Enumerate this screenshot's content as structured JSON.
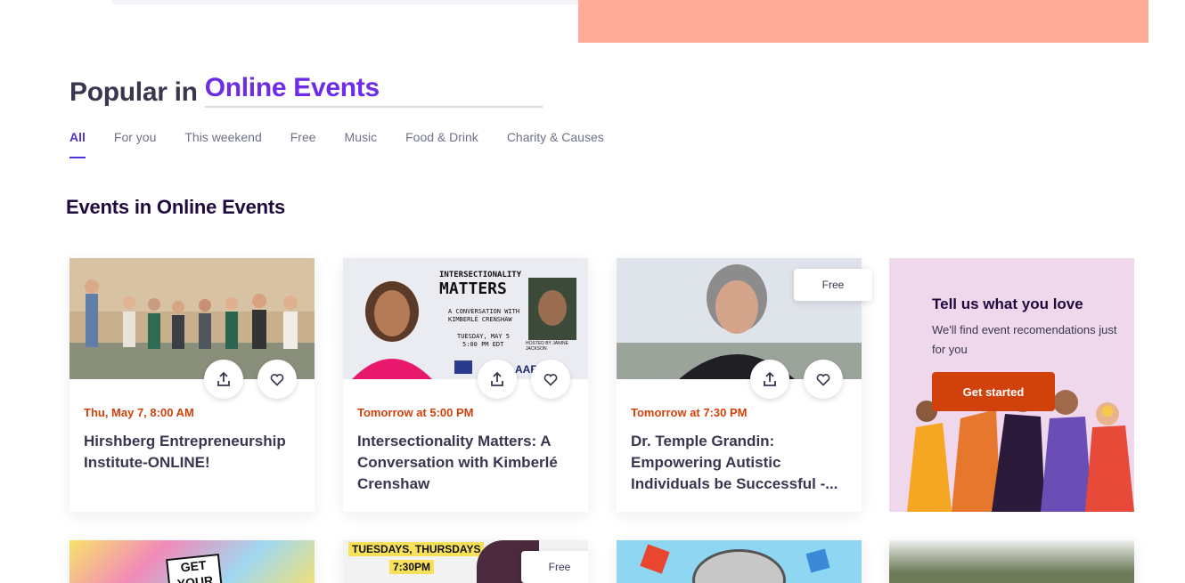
{
  "header": {
    "popular_label": "Popular in",
    "location_value": "Online Events"
  },
  "tabs": [
    {
      "label": "All",
      "active": true
    },
    {
      "label": "For you"
    },
    {
      "label": "This weekend"
    },
    {
      "label": "Free"
    },
    {
      "label": "Music"
    },
    {
      "label": "Food & Drink"
    },
    {
      "label": "Charity & Causes"
    }
  ],
  "section": {
    "title": "Events in Online Events"
  },
  "events": [
    {
      "date": "Thu, May 7, 8:00 AM",
      "title": "Hirshberg Entrepreneurship Institute-ONLINE!"
    },
    {
      "date": "Tomorrow at 5:00 PM",
      "title": "Intersectionality Matters: A Conversation with Kimberlé Crenshaw",
      "poster": {
        "line1": "INTERSECTIONALITY",
        "line2": "MATTERS",
        "line3": "A CONVERSATION WITH",
        "line4": "KIMBERLÉ CRENSHAW",
        "line5": "TUESDAY, MAY 5",
        "line6": "5:00 PM EDT",
        "hosted": "HOSTED BY JANINE JACKSON",
        "logo": "AAR"
      }
    },
    {
      "date": "Tomorrow at 7:30 PM",
      "title": "Dr. Temple Grandin: Empowering Autistic Individuals be Successful -...",
      "badge": "Free"
    }
  ],
  "promo": {
    "title": "Tell us what you love",
    "subtitle": "We'll find event recomendations just for you",
    "button": "Get started"
  },
  "second_row": [
    {
      "text": "GET YOUR"
    },
    {
      "text": "TUESDAYS, THURSDAYS",
      "time": "7:30PM",
      "badge": "Free"
    },
    {},
    {}
  ],
  "colors": {
    "accent": "#6d2ce8",
    "date": "#d1410c",
    "promo_bg": "#f0d8ec",
    "banner": "#ffab97"
  }
}
